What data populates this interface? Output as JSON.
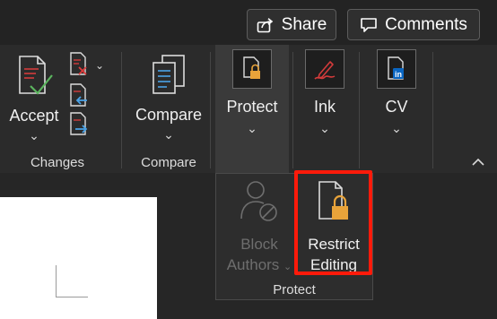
{
  "header": {
    "share_label": "Share",
    "comments_label": "Comments"
  },
  "ribbon": {
    "accept_label": "Accept",
    "compare_label": "Compare",
    "protect_label": "Protect",
    "ink_label": "Ink",
    "cv_label": "CV",
    "groups": {
      "changes": "Changes",
      "compare": "Compare"
    },
    "icons": {
      "accept": "accept-change-icon",
      "reject": "reject-change-icon",
      "previous": "previous-change-icon",
      "next": "next-change-icon",
      "compare": "compare-documents-icon",
      "protect": "protect-lock-icon",
      "ink": "ink-pen-icon",
      "cv": "linkedin-resume-icon"
    }
  },
  "protect_menu": {
    "block_line1": "Block",
    "block_line2": "Authors",
    "restrict_line1": "Restrict",
    "restrict_line2": "Editing",
    "group_label": "Protect"
  },
  "colors": {
    "background": "#262626",
    "ribbon": "#2b2b2b",
    "highlight_border": "#ff1a0a",
    "lock_orange": "#e8a33a",
    "linkedin_blue": "#0a66c2",
    "ink_red": "#d33b3b"
  }
}
